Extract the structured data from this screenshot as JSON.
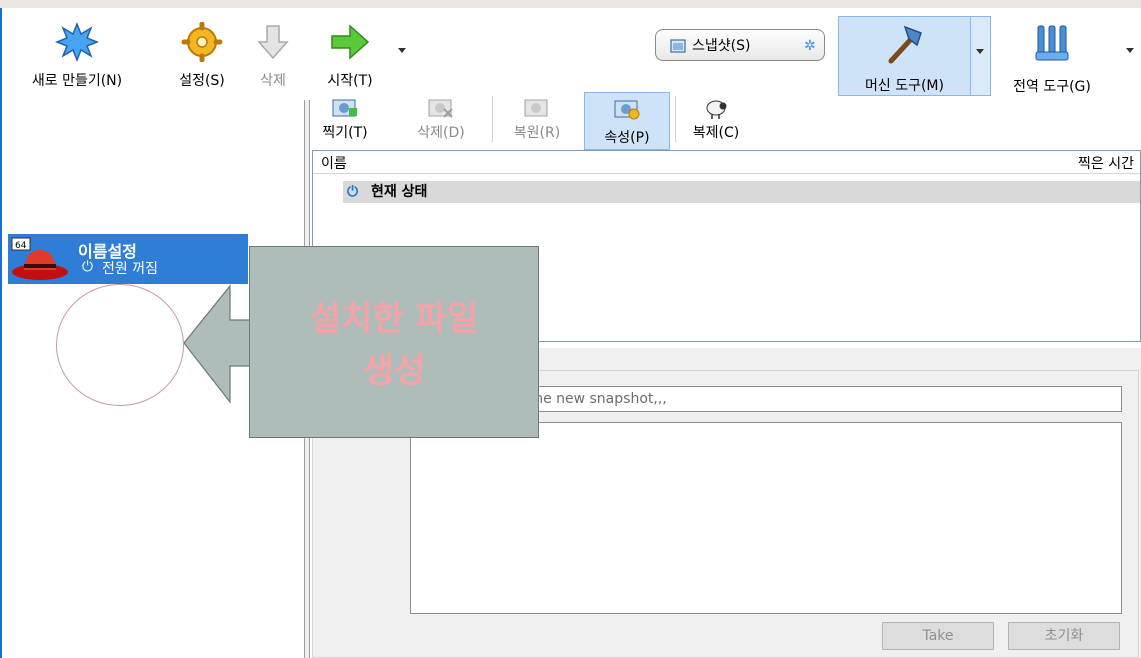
{
  "toolbar": {
    "new_label": "새로 만들기(N)",
    "settings_label": "설정(S)",
    "delete_label": "삭제",
    "start_label": "시작(T)",
    "snapshot_toggle_label": "스냅샷(S)",
    "machine_tools_label": "머신 도구(M)",
    "global_tools_label": "전역 도구(G)"
  },
  "vm": {
    "name": "이름설정",
    "state": "전원 꺼짐",
    "badge": "64"
  },
  "snapshot_toolbar": {
    "take_label": "찍기(T)",
    "delete_label": "삭제(D)",
    "restore_label": "복원(R)",
    "properties_label": "속성(P)",
    "clone_label": "복제(C)"
  },
  "snapshot_list": {
    "columns": [
      "이름",
      "찍은 시간"
    ],
    "current_state": "현재 상태"
  },
  "take_form": {
    "name_placeholder": "for the new snapshot,,,",
    "take_button": "Take",
    "reset_button": "초기화"
  },
  "annotation": {
    "text": "설치한 파일\n생성"
  },
  "colors": {
    "selection_blue": "#2e7ed6",
    "callout_fill": "#aebcba",
    "callout_text": "#f7a2a6",
    "machine_tools_active": "#cfe3f8"
  }
}
